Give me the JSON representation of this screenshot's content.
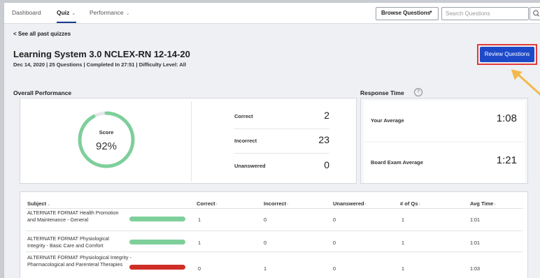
{
  "nav": {
    "dashboard": "Dashboard",
    "quiz": "Quiz",
    "performance": "Performance"
  },
  "toolbar": {
    "browse_label": "Browse Questions",
    "search_placeholder": "Search Questions"
  },
  "back_link": "< See all past quizzes",
  "exam": {
    "title": "Learning System 3.0 NCLEX-RN 12-14-20",
    "meta": "Dec 14, 2020  |  25 Questions  | Completed In 27:51 |  Difficulty Level: All"
  },
  "review_button": "Review Questions",
  "overall": {
    "heading": "Overall Performance",
    "score_label": "Score",
    "score_value": "92%",
    "score_fraction": 0.92,
    "correct_label": "Correct",
    "correct_value": "2",
    "incorrect_label": "Incorrect",
    "incorrect_value": "23",
    "unanswered_label": "Unanswered",
    "unanswered_value": "0"
  },
  "response": {
    "heading": "Response Time",
    "your_label": "Your Average",
    "your_value": "1:08",
    "board_label": "Board Exam Average",
    "board_value": "1:21"
  },
  "table": {
    "headers": {
      "subject": "Subject",
      "correct": "Correct",
      "incorrect": "Incorrect",
      "unanswered": "Unanswered",
      "num_qs": "# of Qs",
      "avg_time": "Avg Time"
    },
    "rows": [
      {
        "subject": "ALTERNATE FORMAT Health Promotion and Maintenance - General",
        "correct": "1",
        "incorrect": "0",
        "unanswered": "0",
        "num_qs": "1",
        "avg_time": "1:01",
        "status": "correct"
      },
      {
        "subject": "ALTERNATE FORMAT Physiological Integrity - Basic Care and Comfort",
        "correct": "1",
        "incorrect": "0",
        "unanswered": "0",
        "num_qs": "1",
        "avg_time": "1:01",
        "status": "correct"
      },
      {
        "subject": "ALTERNATE FORMAT Physiological Integrity - Pharmacological and Parenteral Therapies",
        "correct": "0",
        "incorrect": "1",
        "unanswered": "0",
        "num_qs": "1",
        "avg_time": "1:03",
        "status": "incorrect"
      }
    ]
  },
  "colors": {
    "correct": "#7ecf9a",
    "incorrect": "#cf2e26",
    "primary": "#1d49c9",
    "highlight": "#e23b3b",
    "arrow": "#f4b94a"
  }
}
